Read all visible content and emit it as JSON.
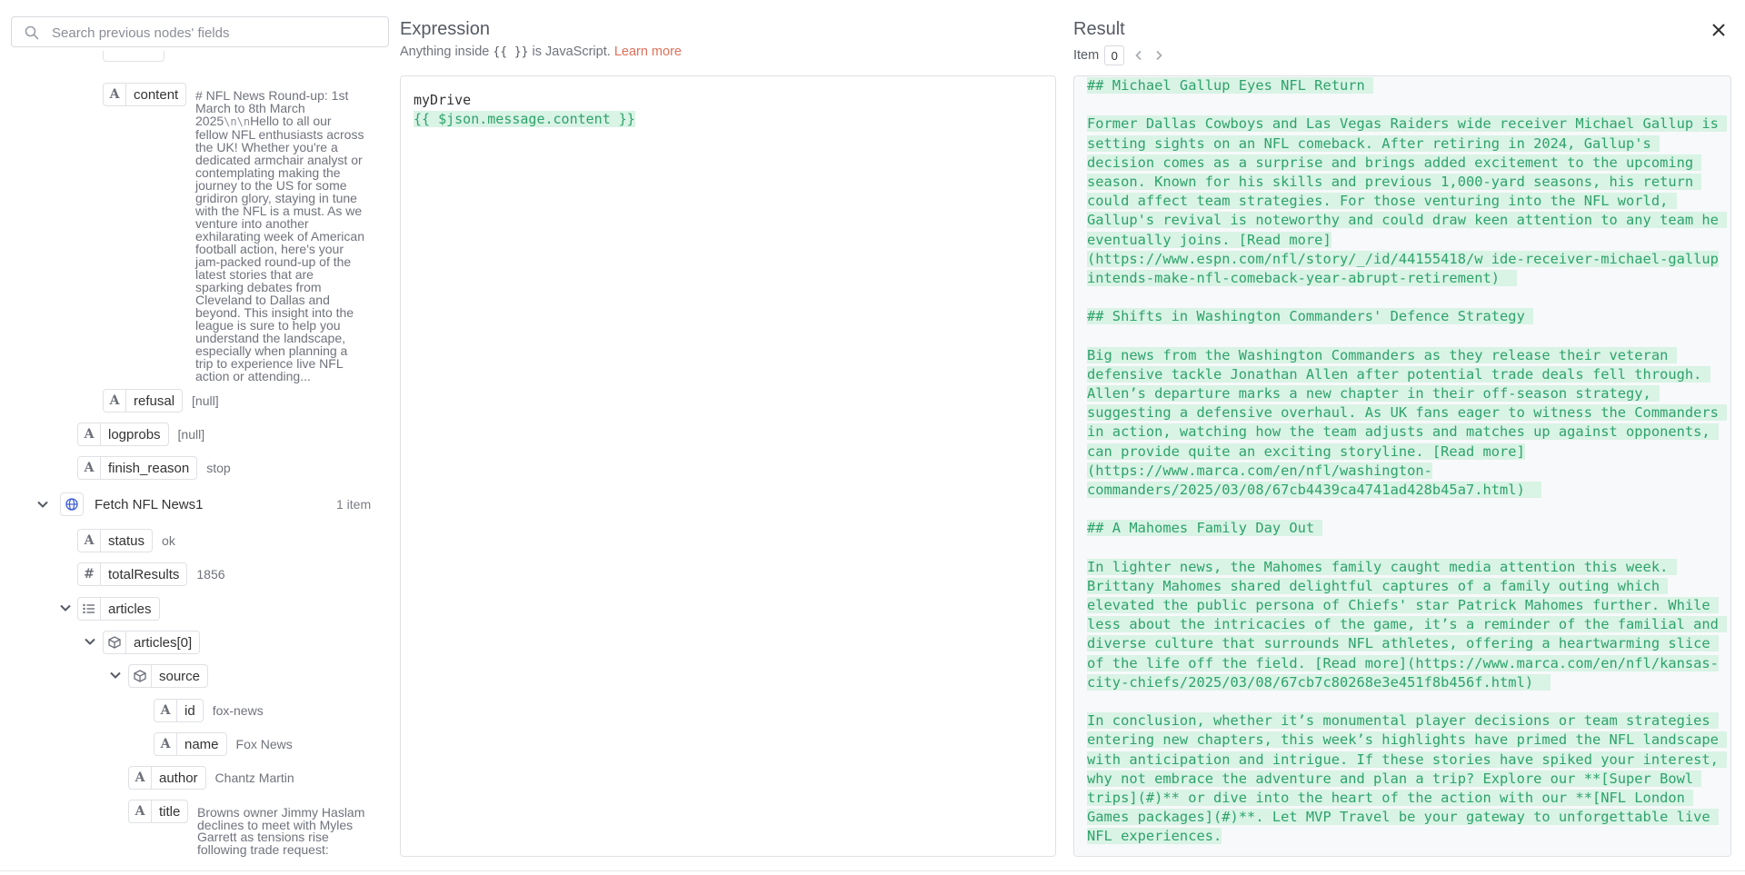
{
  "search": {
    "placeholder": "Search previous nodes' fields"
  },
  "tree": {
    "content": {
      "label": "content",
      "value_lines": [
        "# NFL News Round-up: 1st",
        "March to 8th March",
        "2025\\n\\nHello to all our",
        "fellow NFL enthusiasts across",
        "the UK! Whether you're a",
        "dedicated armchair analyst or",
        "contemplating making the",
        "journey to the US for some",
        "gridiron glory, staying in tune",
        "with the NFL is a must. As we",
        "venture into another",
        "exhilarating week of American",
        "football action, here's your",
        "jam-packed round-up of the",
        "latest stories that are",
        "sparking debates from",
        "Cleveland to Dallas and",
        "beyond. This insight into the",
        "league is sure to help you",
        "understand the landscape,",
        "especially when planning a",
        "trip to experience live NFL",
        "action or attending..."
      ]
    },
    "refusal": {
      "label": "refusal",
      "value": "[null]"
    },
    "logprobs": {
      "label": "logprobs",
      "value": "[null]"
    },
    "finish_reason": {
      "label": "finish_reason",
      "value": "stop"
    },
    "fetch_node": {
      "label": "Fetch NFL News1",
      "count": "1 item"
    },
    "status": {
      "label": "status",
      "value": "ok"
    },
    "totalResults": {
      "label": "totalResults",
      "value": "1856"
    },
    "articles": {
      "label": "articles"
    },
    "articles0": {
      "label": "articles[0]"
    },
    "source": {
      "label": "source"
    },
    "id": {
      "label": "id",
      "value": "fox-news"
    },
    "name": {
      "label": "name",
      "value": "Fox News"
    },
    "author": {
      "label": "author",
      "value": "Chantz Martin"
    },
    "title": {
      "label": "title",
      "value_lines": [
        "Browns owner Jimmy Haslam",
        "declines to meet with Myles",
        "Garrett as tensions rise",
        "following trade request:"
      ]
    },
    "type_icons": {
      "string": "A",
      "number": "#"
    }
  },
  "expression": {
    "title": "Expression",
    "subtitle_pre": "Anything inside",
    "subtitle_braces": "{{ }}",
    "subtitle_mid": "is JavaScript.",
    "learn_more": "Learn more",
    "line1": "myDrive",
    "line2": "{{ $json.message.content }}"
  },
  "result": {
    "title": "Result",
    "item_label": "Item",
    "item_value": "0",
    "lines": [
      "## Michael Gallup Eyes NFL Return ",
      "",
      "Former Dallas Cowboys and Las Vegas Raiders wide receiver Michael Gallup is ",
      "setting sights on an NFL comeback. After retiring in 2024, Gallup's ",
      "decision comes as a surprise and brings added excitement to the upcoming ",
      "season. Known for his skills and previous 1,000-yard seasons, his return ",
      "could affect team strategies. For those venturing into the NFL world, ",
      "Gallup's revival is noteworthy and could draw keen attention to any team he ",
      "eventually joins. [Read more]",
      "(https://www.espn.com/nfl/story/_/id/44155418/w ide-receiver-michael-gallup-",
      "intends-make-nfl-comeback-year-abrupt-retirement)  ",
      "",
      "## Shifts in Washington Commanders' Defence Strategy ",
      "",
      "Big news from the Washington Commanders as they release their veteran ",
      "defensive tackle Jonathan Allen after potential trade deals fell through. ",
      "Allen’s departure marks a new chapter in their off-season strategy, ",
      "suggesting a defensive overhaul. As UK fans eager to witness the Commanders ",
      "in action, watching how the team adjusts and matches up against opponents, ",
      "can provide quite an exciting storyline. [Read more]",
      "(https://www.marca.com/en/nfl/washington-",
      "commanders/2025/03/08/67cb4439ca4741ad428b45a7.html)  ",
      "",
      "## A Mahomes Family Day Out ",
      "",
      "In lighter news, the Mahomes family caught media attention this week. ",
      "Brittany Mahomes shared delightful captures of a family outing which ",
      "elevated the public persona of Chiefs' star Patrick Mahomes further. While ",
      "less about the intricacies of the game, it’s a reminder of the familial and ",
      "diverse culture that surrounds NFL athletes, offering a heartwarming slice ",
      "of the life off the field. [Read more](https://www.marca.com/en/nfl/kansas-",
      "city-chiefs/2025/03/08/67cb7c80268e3e451f8b456f.html)  ",
      "",
      "In conclusion, whether it’s monumental player decisions or team strategies ",
      "entering new chapters, this week’s highlights have primed the NFL landscape ",
      "with anticipation and intrigue. If these stories have spiked your interest, ",
      "why not embrace the adventure and plan a trip? Explore our **[Super Bowl ",
      "trips](#)** or dive into the heart of the action with our **[NFL London ",
      "Games packages](#)**. Let MVP Travel be your gateway to unforgettable live ",
      "NFL experiences."
    ]
  },
  "colors": {
    "accent_link": "#e0705a",
    "expression_green": "#2ea36b",
    "highlight_bg": "#d9f3e5",
    "node_icon": "#3b5bdb"
  }
}
